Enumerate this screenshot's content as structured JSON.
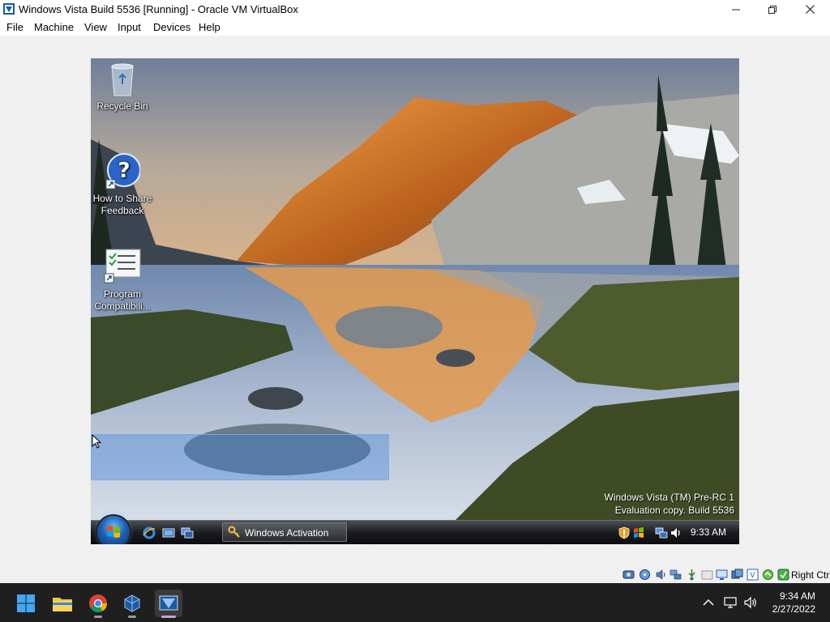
{
  "window": {
    "title": "Windows Vista Build 5536 [Running] - Oracle VM VirtualBox",
    "controls": [
      "minimize",
      "restore",
      "close"
    ]
  },
  "menu": [
    "File",
    "Machine",
    "View",
    "Input",
    "Devices",
    "Help"
  ],
  "vm": {
    "desktop_icons": [
      {
        "label": "Recycle Bin",
        "icon": "recycle-bin-icon"
      },
      {
        "label": "How to Share Feedback",
        "icon": "help-icon"
      },
      {
        "label": "Program Compatibili...",
        "icon": "program-compatibility-icon"
      }
    ],
    "watermark": {
      "line1": "Windows Vista (TM) Pre-RC 1",
      "line2": "Evaluation copy. Build 5536"
    },
    "taskbar": {
      "quick_launch": [
        "internet-explorer-icon",
        "show-desktop-icon",
        "switch-windows-icon"
      ],
      "task_button": "Windows Activation",
      "tray_icons": [
        "security-shield-icon",
        "windows-flag-icon",
        "network-icon",
        "volume-icon"
      ],
      "clock": "9:33 AM"
    }
  },
  "statusbar": {
    "icons": [
      "hard-disk-icon",
      "optical-drive-icon",
      "audio-icon",
      "network-adapter-icon",
      "usb-icon",
      "shared-folders-icon",
      "display-icon",
      "video-capture-icon",
      "cpu-icon",
      "mouse-integration-icon",
      "keyboard-icon"
    ],
    "host_key": "Right Ctrl"
  },
  "host_taskbar": {
    "apps": [
      "windows-start-icon",
      "file-explorer-icon",
      "chrome-icon",
      "virtualbox-icon",
      "vista-vm-icon"
    ],
    "tray_icons": [
      "chevron-up-icon",
      "network-icon",
      "volume-icon"
    ],
    "time": "9:34 AM",
    "date": "2/27/2022"
  },
  "colors": {
    "selection": "#3378dc",
    "host_taskbar": "#1f1f1f",
    "vista_taskbar": "#1b1c1f"
  }
}
